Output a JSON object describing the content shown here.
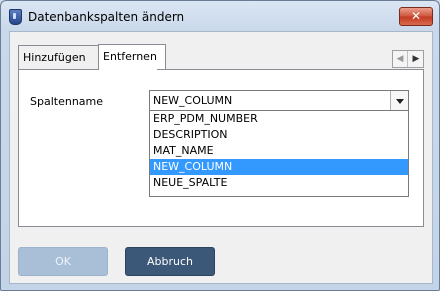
{
  "window": {
    "title": "Datenbankspalten ändern",
    "close_label": "✕"
  },
  "tabs": [
    {
      "label": "Hinzufügen",
      "active": false
    },
    {
      "label": "Entfernen",
      "active": true
    }
  ],
  "tab_scroll": {
    "left": "◀",
    "right": "▶"
  },
  "form": {
    "column_label": "Spaltenname",
    "selected_value": "NEW_COLUMN",
    "options": [
      "ERP_PDM_NUMBER",
      "DESCRIPTION",
      "MAT_NAME",
      "NEW_COLUMN",
      "NEUE_SPALTE"
    ],
    "highlighted_option": "NEW_COLUMN"
  },
  "buttons": {
    "ok_label": "OK",
    "ok_enabled": false,
    "cancel_label": "Abbruch"
  }
}
